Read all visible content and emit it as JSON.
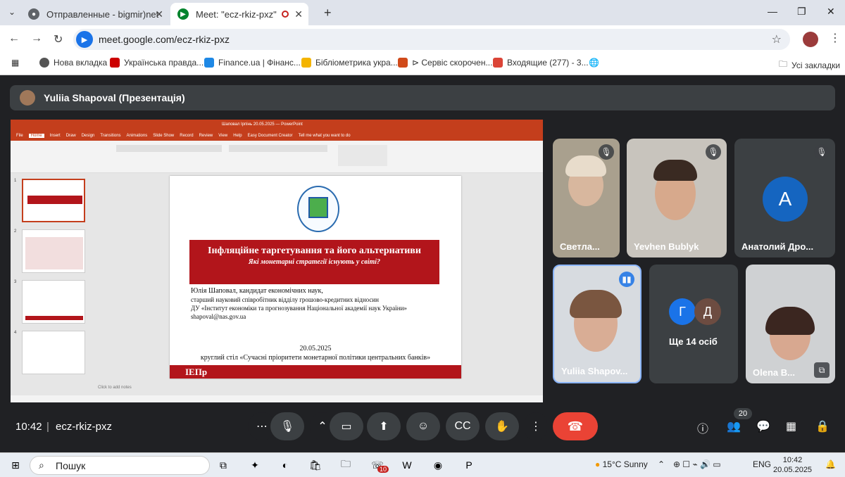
{
  "browser": {
    "tabs": [
      {
        "title": "Отправленные - bigmir)net",
        "active": false
      },
      {
        "title": "Meet: \"ecz-rkiz-pxz\"",
        "active": true
      }
    ],
    "url": "meet.google.com/ecz-rkiz-pxz",
    "bookmarks": [
      {
        "label": "Нова вкладка",
        "color": "#555"
      },
      {
        "label": "Українська правда...",
        "color": "#c00"
      },
      {
        "label": "Finance.ua | Фінанс...",
        "color": "#1e88e5"
      },
      {
        "label": "Бібліометрика укра...",
        "color": "#f4b400"
      },
      {
        "label": "⊳ Сервіс скорочен...",
        "color": "#d04a1a"
      },
      {
        "label": "Входящие (277) - 3...",
        "color": "#db4437"
      }
    ],
    "all_bookmarks": "Усі закладки"
  },
  "presenter": {
    "name": "Yuliia Shapoval (Презентація)"
  },
  "presentation": {
    "window_title": "Шаповал Ірпінь 20.05.2025 — PowerPoint",
    "menu": [
      "File",
      "Home",
      "Insert",
      "Draw",
      "Design",
      "Transitions",
      "Animations",
      "Slide Show",
      "Record",
      "Review",
      "View",
      "Help",
      "Easy Document Creator",
      "Tell me what you want to do"
    ],
    "slide": {
      "title": "Інфляційне таргетування та його альтернативи",
      "subtitle": "Які монетарні стратегії існують у світі?",
      "author": "Юлія Шаповал, кандидат економічних наук,",
      "position": "старший науковий співробітник відділу грошово-кредитних відносин",
      "institution": "ДУ «Інститут економіки та прогнозування Національної академії наук України»",
      "email": "shapoval@nas.gov.ua",
      "date": "20.05.2025",
      "event": "круглий стіл «Сучасні пріоритети монетарної політики центральних банків»",
      "footer": "ІЕПр"
    },
    "thumb_numbers": [
      "1",
      "2",
      "3",
      "4"
    ],
    "notes_placeholder": "Click to add notes"
  },
  "participants": [
    {
      "name": "Светла...",
      "muted": true
    },
    {
      "name": "Yevhen Bublyk",
      "muted": true
    },
    {
      "name": "Анатолий Дро...",
      "muted": true,
      "initial": "A"
    },
    {
      "name": "Yuliia Shapov...",
      "speaking": true
    },
    {
      "name": "Ще 14 осіб",
      "initials": [
        "Г",
        "Д"
      ]
    },
    {
      "name": "Olena B..."
    }
  ],
  "controls": {
    "time": "10:42",
    "meeting_code": "ecz-rkiz-pxz",
    "participant_count": "20"
  },
  "taskbar": {
    "search": "Пошук",
    "weather": "15°C  Sunny",
    "lang": "ENG",
    "time": "10:42",
    "date": "20.05.2025",
    "badge": "10"
  }
}
